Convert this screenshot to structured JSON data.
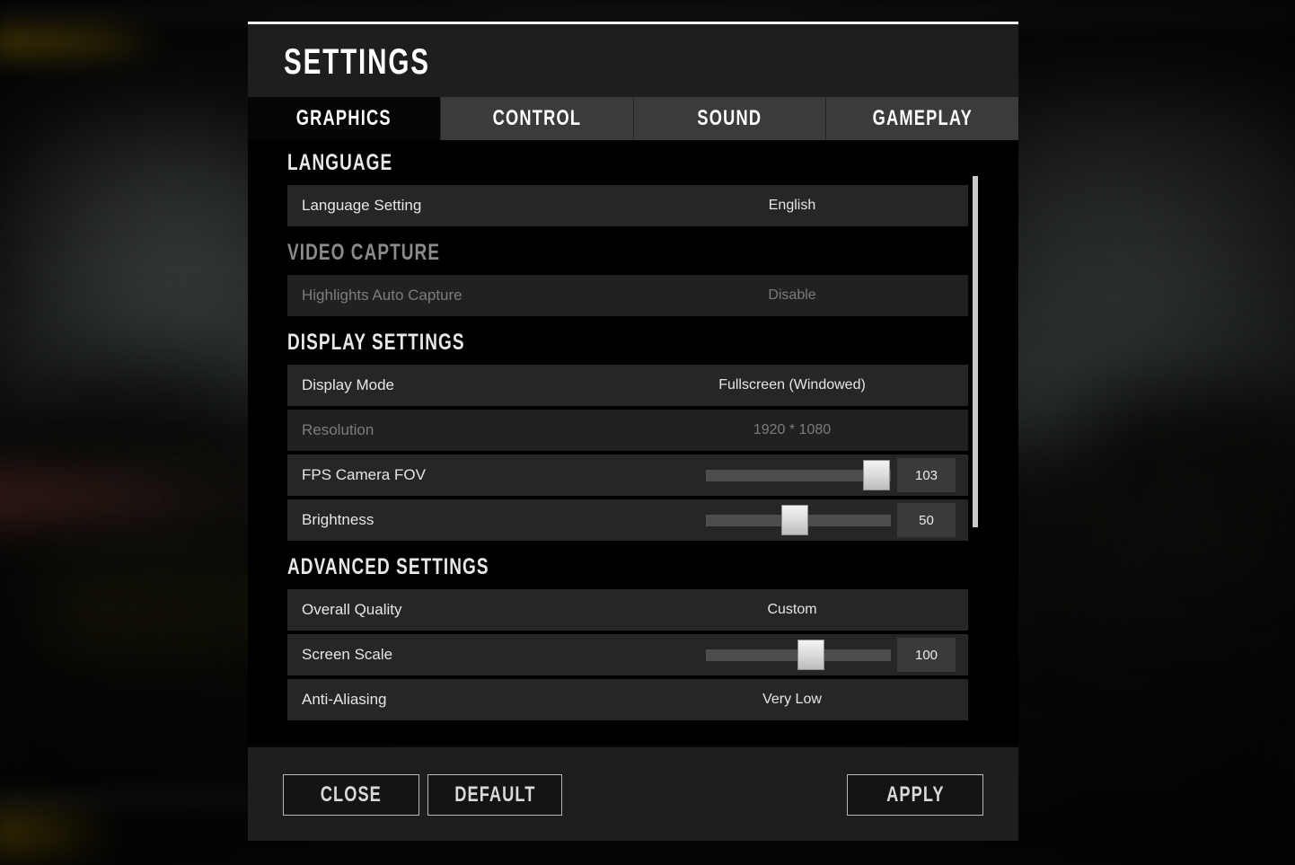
{
  "window": {
    "title": "SETTINGS"
  },
  "tabs": [
    {
      "label": "GRAPHICS",
      "active": true
    },
    {
      "label": "CONTROL",
      "active": false
    },
    {
      "label": "SOUND",
      "active": false
    },
    {
      "label": "GAMEPLAY",
      "active": false
    }
  ],
  "sections": [
    {
      "heading": "LANGUAGE",
      "dimmed": false,
      "rows": [
        {
          "label": "Language Setting",
          "value": "English",
          "type": "value",
          "disabled": false
        }
      ]
    },
    {
      "heading": "VIDEO CAPTURE",
      "dimmed": true,
      "rows": [
        {
          "label": "Highlights Auto Capture",
          "value": "Disable",
          "type": "value",
          "disabled": true
        }
      ]
    },
    {
      "heading": "DISPLAY SETTINGS",
      "dimmed": false,
      "rows": [
        {
          "label": "Display Mode",
          "value": "Fullscreen (Windowed)",
          "type": "value",
          "disabled": false
        },
        {
          "label": "Resolution",
          "value": "1920 * 1080",
          "type": "value",
          "disabled": true
        },
        {
          "label": "FPS Camera FOV",
          "value": "103",
          "type": "slider",
          "fill_percent": 92,
          "disabled": false
        },
        {
          "label": "Brightness",
          "value": "50",
          "type": "slider",
          "fill_percent": 48,
          "disabled": false
        }
      ]
    },
    {
      "heading": "ADVANCED SETTINGS",
      "dimmed": false,
      "rows": [
        {
          "label": "Overall Quality",
          "value": "Custom",
          "type": "value",
          "disabled": false
        },
        {
          "label": "Screen Scale",
          "value": "100",
          "type": "slider",
          "fill_percent": 57,
          "disabled": false
        },
        {
          "label": "Anti-Aliasing",
          "value": "Very Low",
          "type": "value",
          "disabled": false
        }
      ]
    }
  ],
  "scrollbar": {
    "thumb_top_percent": 6,
    "thumb_height_percent": 58
  },
  "footer": {
    "buttons": [
      {
        "id": "close",
        "label": "CLOSE"
      },
      {
        "id": "default",
        "label": "DEFAULT"
      },
      {
        "id": "apply",
        "label": "APPLY"
      }
    ]
  },
  "colors": {
    "dialog_bg": "#1e1e1e",
    "content_bg": "#000000",
    "row_bg": "#262626",
    "row_bg_alt": "#212121",
    "text_primary": "#e6e6e6",
    "text_dim": "#7c7c7c",
    "heading": "#e8e8e8",
    "heading_dim": "#8b8b8b",
    "slider_track": "#4d4d4d",
    "slider_handle": "#dcdcdc",
    "button_border": "#b9b9b9",
    "scrollbar_thumb": "#c9c9c9",
    "tab_inactive": "#3b3b3b",
    "tab_active": "#050505"
  }
}
